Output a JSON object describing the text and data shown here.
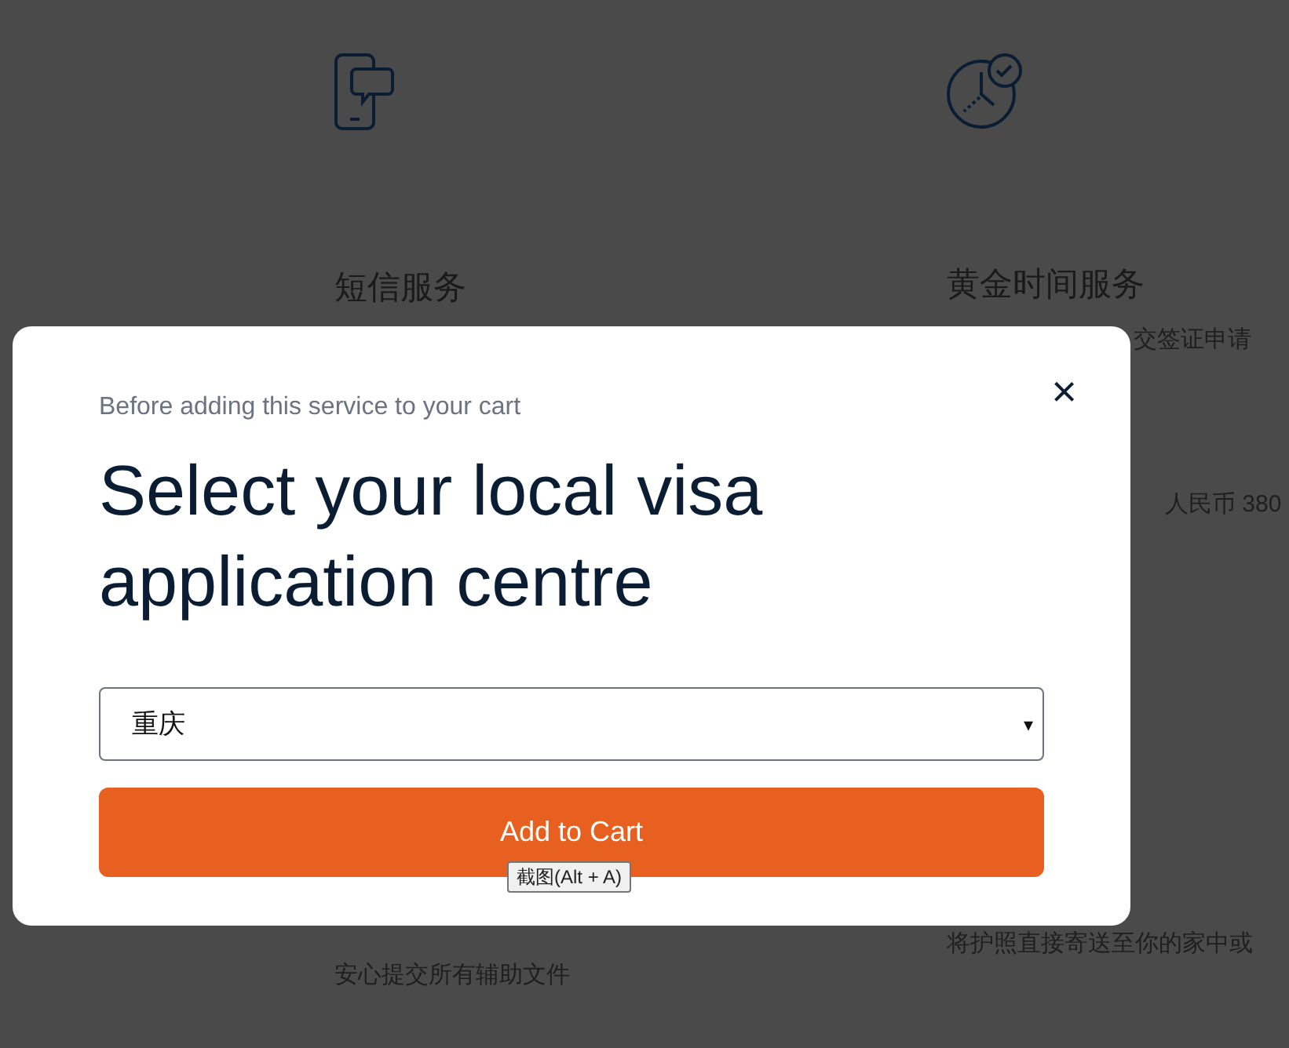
{
  "background": {
    "columns": [
      {},
      {
        "title": "短信服务",
        "description": "安心提交所有辅助文件"
      },
      {
        "title": "黄金时间服务",
        "texts": [
          "交签证申请",
          "人民币 380"
        ],
        "description": "将护照直接寄送至你的家中或"
      }
    ]
  },
  "modal": {
    "subtitle": "Before adding this service to your cart",
    "title": "Select your local visa application centre",
    "close": "×",
    "select": {
      "value": "重庆",
      "caret": "▾"
    },
    "button": "Add to Cart"
  },
  "tooltip": "截图(Alt + A)"
}
